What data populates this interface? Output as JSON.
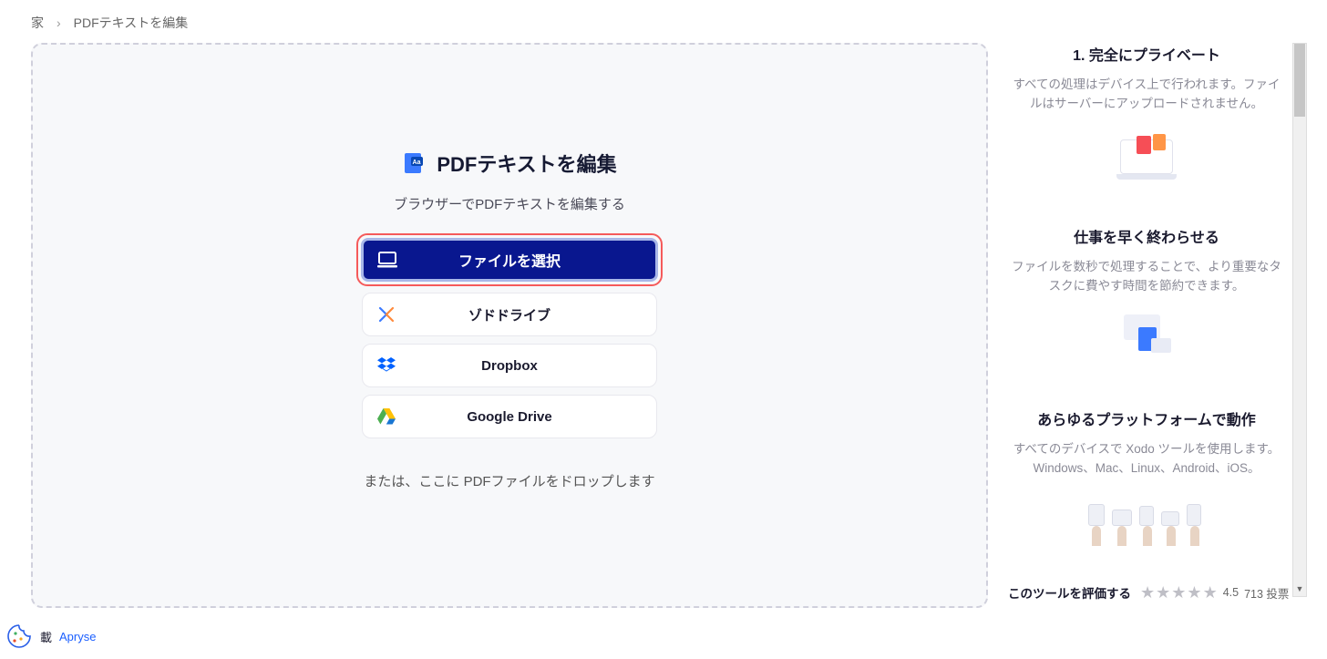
{
  "breadcrumb": {
    "home": "家",
    "page": "PDFテキストを編集"
  },
  "main": {
    "title": "PDFテキストを編集",
    "subtitle": "ブラウザーでPDFテキストを編集する",
    "select_file": "ファイルを選択",
    "xodo_drive": "ゾドドライブ",
    "dropbox": "Dropbox",
    "google_drive": "Google Drive",
    "drop_hint": "または、ここに PDFファイルをドロップします"
  },
  "features": [
    {
      "title": "1. 完全にプライベート",
      "desc": "すべての処理はデバイス上で行われます。ファイルはサーバーにアップロードされません。"
    },
    {
      "title": "仕事を早く終わらせる",
      "desc": "ファイルを数秒で処理することで、より重要なタスクに費やす時間を節約できます。"
    },
    {
      "title": "あらゆるプラットフォームで動作",
      "desc": "すべてのデバイスで Xodo ツールを使用します。 Windows、Mac、Linux、Android、iOS。"
    }
  ],
  "rating": {
    "label": "このツールを評価する",
    "value": "4.5",
    "votes": "713 投票"
  },
  "footer": {
    "text": "載",
    "brand": "Apryse"
  }
}
